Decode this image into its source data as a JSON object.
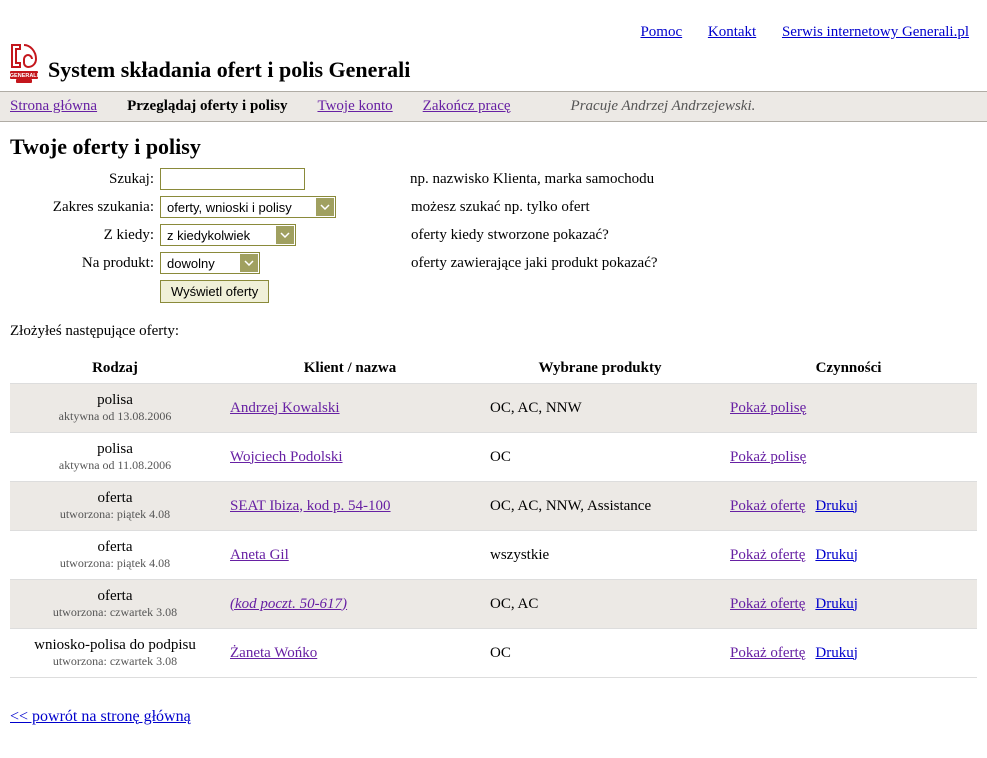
{
  "top_links": {
    "help": "Pomoc",
    "contact": "Kontakt",
    "website": "Serwis internetowy Generali.pl"
  },
  "header": {
    "title": "System składania ofert i polis Generali"
  },
  "nav": {
    "home": "Strona główna",
    "browse": "Przeglądaj oferty i polisy",
    "account": "Twoje konto",
    "logout": "Zakończ pracę",
    "user_status": "Pracuje Andrzej Andrzejewski."
  },
  "page_heading": "Twoje oferty i polisy",
  "form": {
    "search_label": "Szukaj:",
    "search_hint": "np. nazwisko Klienta, marka samochodu",
    "scope_label": "Zakres szukania:",
    "scope_value": "oferty, wnioski i polisy",
    "scope_hint": "możesz szukać np. tylko ofert",
    "when_label": "Z kiedy:",
    "when_value": "z kiedykolwiek",
    "when_hint": "oferty kiedy stworzone pokazać?",
    "product_label": "Na produkt:",
    "product_value": "dowolny",
    "product_hint": "oferty zawierające jaki produkt pokazać?",
    "submit": "Wyświetl oferty"
  },
  "intro": "Złożyłeś następujące oferty:",
  "table": {
    "headers": {
      "kind": "Rodzaj",
      "client": "Klient / nazwa",
      "products": "Wybrane produkty",
      "actions": "Czynności"
    },
    "rows": [
      {
        "kind": "polisa",
        "sub": "aktywna od 13.08.2006",
        "client": "Andrzej Kowalski",
        "client_italic": false,
        "products": "OC, AC, NNW",
        "show": "Pokaż polisę",
        "print": ""
      },
      {
        "kind": "polisa",
        "sub": "aktywna od 11.08.2006",
        "client": "Wojciech Podolski",
        "client_italic": false,
        "products": "OC",
        "show": "Pokaż polisę",
        "print": ""
      },
      {
        "kind": "oferta",
        "sub": "utworzona: piątek 4.08",
        "client": "SEAT Ibiza, kod p. 54-100",
        "client_italic": false,
        "products": "OC, AC, NNW, Assistance",
        "show": "Pokaż ofertę",
        "print": "Drukuj"
      },
      {
        "kind": "oferta",
        "sub": "utworzona: piątek 4.08",
        "client": "Aneta Gil",
        "client_italic": false,
        "products": "wszystkie",
        "show": "Pokaż ofertę",
        "print": "Drukuj"
      },
      {
        "kind": "oferta",
        "sub": "utworzona: czwartek 3.08",
        "client": "(kod poczt. 50-617)",
        "client_italic": true,
        "products": "OC, AC",
        "show": "Pokaż ofertę",
        "print": "Drukuj"
      },
      {
        "kind": "wniosko-polisa do podpisu",
        "sub": "utworzona: czwartek 3.08",
        "client": "Żaneta Wońko",
        "client_italic": false,
        "products": "OC",
        "show": "Pokaż ofertę",
        "print": "Drukuj"
      }
    ]
  },
  "back_link": "<< powrót na stronę główną"
}
